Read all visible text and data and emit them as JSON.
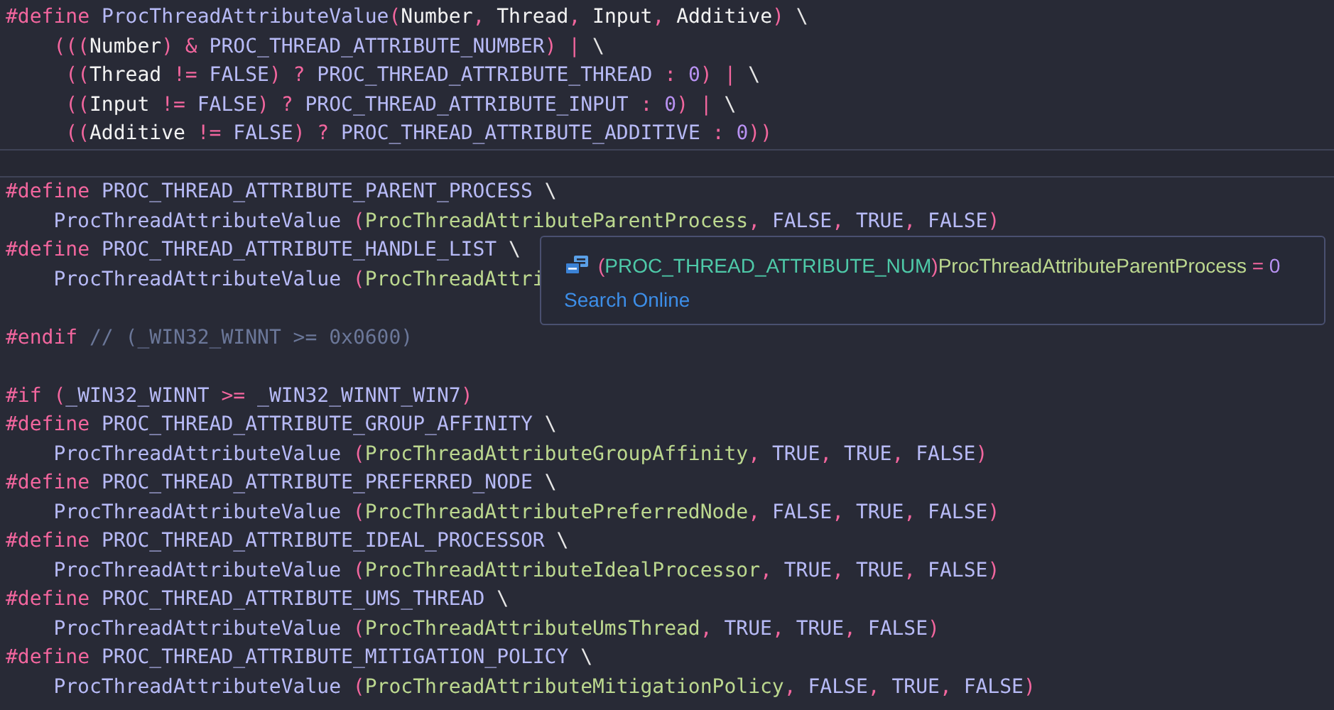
{
  "editor": {
    "lines": [
      {
        "current": false,
        "kind": "top",
        "tokens": [
          {
            "kind": "keyword",
            "text": "#define"
          },
          {
            "kind": "macro",
            "text": " ProcThreadAttributeValue"
          },
          {
            "kind": "punct",
            "text": "("
          },
          {
            "kind": "param",
            "text": "Number"
          },
          {
            "kind": "punct",
            "text": ", "
          },
          {
            "kind": "param",
            "text": "Thread"
          },
          {
            "kind": "punct",
            "text": ", "
          },
          {
            "kind": "param",
            "text": "Input"
          },
          {
            "kind": "punct",
            "text": ", "
          },
          {
            "kind": "param",
            "text": "Additive"
          },
          {
            "kind": "punct",
            "text": ")"
          },
          {
            "kind": "plain",
            "text": " \\"
          }
        ]
      },
      {
        "current": false,
        "kind": "continuation",
        "tokens": [
          {
            "kind": "punct",
            "text": "((("
          },
          {
            "kind": "param",
            "text": "Number"
          },
          {
            "kind": "punct",
            "text": ") & "
          },
          {
            "kind": "macro",
            "text": "PROC_THREAD_ATTRIBUTE_NUMBER"
          },
          {
            "kind": "punct",
            "text": ") | "
          },
          {
            "kind": "plain",
            "text": "\\"
          }
        ]
      },
      {
        "current": false,
        "kind": "continuation_inner",
        "tokens": [
          {
            "kind": "punct",
            "text": "(("
          },
          {
            "kind": "param",
            "text": "Thread"
          },
          {
            "kind": "punct",
            "text": " != "
          },
          {
            "kind": "macro",
            "text": "FALSE"
          },
          {
            "kind": "punct",
            "text": ") ? "
          },
          {
            "kind": "macro",
            "text": "PROC_THREAD_ATTRIBUTE_THREAD"
          },
          {
            "kind": "punct",
            "text": " : "
          },
          {
            "kind": "number",
            "text": "0"
          },
          {
            "kind": "punct",
            "text": ") | "
          },
          {
            "kind": "plain",
            "text": "\\"
          }
        ]
      },
      {
        "current": false,
        "kind": "continuation_inner",
        "tokens": [
          {
            "kind": "punct",
            "text": "(("
          },
          {
            "kind": "param",
            "text": "Input"
          },
          {
            "kind": "punct",
            "text": " != "
          },
          {
            "kind": "macro",
            "text": "FALSE"
          },
          {
            "kind": "punct",
            "text": ") ? "
          },
          {
            "kind": "macro",
            "text": "PROC_THREAD_ATTRIBUTE_INPUT"
          },
          {
            "kind": "punct",
            "text": " : "
          },
          {
            "kind": "number",
            "text": "0"
          },
          {
            "kind": "punct",
            "text": ") | "
          },
          {
            "kind": "plain",
            "text": "\\"
          }
        ]
      },
      {
        "current": false,
        "kind": "continuation_inner",
        "tokens": [
          {
            "kind": "punct",
            "text": "(("
          },
          {
            "kind": "param",
            "text": "Additive"
          },
          {
            "kind": "punct",
            "text": " != "
          },
          {
            "kind": "macro",
            "text": "FALSE"
          },
          {
            "kind": "punct",
            "text": ") ? "
          },
          {
            "kind": "macro",
            "text": "PROC_THREAD_ATTRIBUTE_ADDITIVE"
          },
          {
            "kind": "punct",
            "text": " : "
          },
          {
            "kind": "number",
            "text": "0"
          },
          {
            "kind": "punct",
            "text": "))"
          }
        ]
      },
      {
        "current": true,
        "kind": "top"
      },
      {
        "current": false,
        "kind": "top",
        "tokens": [
          {
            "kind": "keyword",
            "text": "#define"
          },
          {
            "kind": "macro",
            "text": " PROC_THREAD_ATTRIBUTE_PARENT_PROCESS"
          },
          {
            "kind": "plain",
            "text": " \\"
          }
        ]
      },
      {
        "current": false,
        "kind": "continuation",
        "tokens": [
          {
            "kind": "macro",
            "text": "ProcThreadAttributeValue"
          },
          {
            "kind": "punct",
            "text": " ("
          },
          {
            "kind": "arg",
            "text": "ProcThreadAttributeParentProcess"
          },
          {
            "kind": "punct",
            "text": ", "
          },
          {
            "kind": "macro",
            "text": "FALSE"
          },
          {
            "kind": "punct",
            "text": ", "
          },
          {
            "kind": "macro",
            "text": "TRUE"
          },
          {
            "kind": "punct",
            "text": ", "
          },
          {
            "kind": "macro",
            "text": "FALSE"
          },
          {
            "kind": "punct",
            "text": ")"
          }
        ]
      },
      {
        "current": false,
        "kind": "top",
        "tokens": [
          {
            "kind": "keyword",
            "text": "#define"
          },
          {
            "kind": "macro",
            "text": " PROC_THREAD_ATTRIBUTE_HANDLE_LIST"
          },
          {
            "kind": "plain",
            "text": " \\"
          }
        ]
      },
      {
        "current": false,
        "kind": "continuation",
        "tokens": [
          {
            "kind": "macro",
            "text": "ProcThreadAttributeValue"
          },
          {
            "kind": "punct",
            "text": " ("
          },
          {
            "kind": "arg",
            "text": "ProcThreadAttri"
          }
        ]
      },
      {
        "current": false,
        "kind": "top"
      },
      {
        "current": false,
        "kind": "top",
        "tokens": [
          {
            "kind": "keyword",
            "text": "#endif"
          },
          {
            "kind": "comment",
            "text": " // (_WIN32_WINNT >= 0x0600)"
          }
        ]
      },
      {
        "current": false,
        "kind": "top"
      },
      {
        "current": false,
        "kind": "top",
        "tokens": [
          {
            "kind": "keyword",
            "text": "#if"
          },
          {
            "kind": "punct",
            "text": " ("
          },
          {
            "kind": "macro",
            "text": "_WIN32_WINNT"
          },
          {
            "kind": "punct",
            "text": " >= "
          },
          {
            "kind": "macro",
            "text": "_WIN32_WINNT_WIN7"
          },
          {
            "kind": "punct",
            "text": ")"
          }
        ]
      },
      {
        "current": false,
        "kind": "top",
        "tokens": [
          {
            "kind": "keyword",
            "text": "#define"
          },
          {
            "kind": "macro",
            "text": " PROC_THREAD_ATTRIBUTE_GROUP_AFFINITY"
          },
          {
            "kind": "plain",
            "text": " \\"
          }
        ]
      },
      {
        "current": false,
        "kind": "continuation",
        "tokens": [
          {
            "kind": "macro",
            "text": "ProcThreadAttributeValue"
          },
          {
            "kind": "punct",
            "text": " ("
          },
          {
            "kind": "arg",
            "text": "ProcThreadAttributeGroupAffinity"
          },
          {
            "kind": "punct",
            "text": ", "
          },
          {
            "kind": "macro",
            "text": "TRUE"
          },
          {
            "kind": "punct",
            "text": ", "
          },
          {
            "kind": "macro",
            "text": "TRUE"
          },
          {
            "kind": "punct",
            "text": ", "
          },
          {
            "kind": "macro",
            "text": "FALSE"
          },
          {
            "kind": "punct",
            "text": ")"
          }
        ]
      },
      {
        "current": false,
        "kind": "top",
        "tokens": [
          {
            "kind": "keyword",
            "text": "#define"
          },
          {
            "kind": "macro",
            "text": " PROC_THREAD_ATTRIBUTE_PREFERRED_NODE"
          },
          {
            "kind": "plain",
            "text": " \\"
          }
        ]
      },
      {
        "current": false,
        "kind": "continuation",
        "tokens": [
          {
            "kind": "macro",
            "text": "ProcThreadAttributeValue"
          },
          {
            "kind": "punct",
            "text": " ("
          },
          {
            "kind": "arg",
            "text": "ProcThreadAttributePreferredNode"
          },
          {
            "kind": "punct",
            "text": ", "
          },
          {
            "kind": "macro",
            "text": "FALSE"
          },
          {
            "kind": "punct",
            "text": ", "
          },
          {
            "kind": "macro",
            "text": "TRUE"
          },
          {
            "kind": "punct",
            "text": ", "
          },
          {
            "kind": "macro",
            "text": "FALSE"
          },
          {
            "kind": "punct",
            "text": ")"
          }
        ]
      },
      {
        "current": false,
        "kind": "top",
        "tokens": [
          {
            "kind": "keyword",
            "text": "#define"
          },
          {
            "kind": "macro",
            "text": " PROC_THREAD_ATTRIBUTE_IDEAL_PROCESSOR"
          },
          {
            "kind": "plain",
            "text": " \\"
          }
        ]
      },
      {
        "current": false,
        "kind": "continuation",
        "tokens": [
          {
            "kind": "macro",
            "text": "ProcThreadAttributeValue"
          },
          {
            "kind": "punct",
            "text": " ("
          },
          {
            "kind": "arg",
            "text": "ProcThreadAttributeIdealProcessor"
          },
          {
            "kind": "punct",
            "text": ", "
          },
          {
            "kind": "macro",
            "text": "TRUE"
          },
          {
            "kind": "punct",
            "text": ", "
          },
          {
            "kind": "macro",
            "text": "TRUE"
          },
          {
            "kind": "punct",
            "text": ", "
          },
          {
            "kind": "macro",
            "text": "FALSE"
          },
          {
            "kind": "punct",
            "text": ")"
          }
        ]
      },
      {
        "current": false,
        "kind": "top",
        "tokens": [
          {
            "kind": "keyword",
            "text": "#define"
          },
          {
            "kind": "macro",
            "text": " PROC_THREAD_ATTRIBUTE_UMS_THREAD"
          },
          {
            "kind": "plain",
            "text": " \\"
          }
        ]
      },
      {
        "current": false,
        "kind": "continuation",
        "tokens": [
          {
            "kind": "macro",
            "text": "ProcThreadAttributeValue"
          },
          {
            "kind": "punct",
            "text": " ("
          },
          {
            "kind": "arg",
            "text": "ProcThreadAttributeUmsThread"
          },
          {
            "kind": "punct",
            "text": ", "
          },
          {
            "kind": "macro",
            "text": "TRUE"
          },
          {
            "kind": "punct",
            "text": ", "
          },
          {
            "kind": "macro",
            "text": "TRUE"
          },
          {
            "kind": "punct",
            "text": ", "
          },
          {
            "kind": "macro",
            "text": "FALSE"
          },
          {
            "kind": "punct",
            "text": ")"
          }
        ]
      },
      {
        "current": false,
        "kind": "top",
        "tokens": [
          {
            "kind": "keyword",
            "text": "#define"
          },
          {
            "kind": "macro",
            "text": " PROC_THREAD_ATTRIBUTE_MITIGATION_POLICY"
          },
          {
            "kind": "plain",
            "text": " \\"
          }
        ]
      },
      {
        "current": false,
        "kind": "continuation",
        "tokens": [
          {
            "kind": "macro",
            "text": "ProcThreadAttributeValue"
          },
          {
            "kind": "punct",
            "text": " ("
          },
          {
            "kind": "arg",
            "text": "ProcThreadAttributeMitigationPolicy"
          },
          {
            "kind": "punct",
            "text": ", "
          },
          {
            "kind": "macro",
            "text": "FALSE"
          },
          {
            "kind": "punct",
            "text": ", "
          },
          {
            "kind": "macro",
            "text": "TRUE"
          },
          {
            "kind": "punct",
            "text": ", "
          },
          {
            "kind": "macro",
            "text": "FALSE"
          },
          {
            "kind": "punct",
            "text": ")"
          }
        ]
      }
    ]
  },
  "hover_tooltip": {
    "signature": [
      {
        "kind": "punct",
        "text": "("
      },
      {
        "kind": "type",
        "text": "PROC_THREAD_ATTRIBUTE_NUM"
      },
      {
        "kind": "punct",
        "text": ")"
      },
      {
        "kind": "arg",
        "text": "ProcThreadAttributeParentProcess"
      },
      {
        "kind": "punct",
        "text": " = "
      },
      {
        "kind": "number",
        "text": "0"
      }
    ],
    "link": "Search Online"
  }
}
